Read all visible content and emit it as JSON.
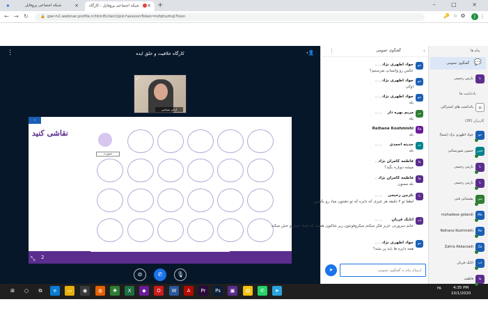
{
  "browser": {
    "tabs": [
      {
        "label": "شبکه اجتماعی پروفایل"
      },
      {
        "label": "شبکه اجتماعی پروفایل - کارگاه"
      }
    ],
    "url": "gwr-h2.webinar.profile.ir/html5client/join?sessionToken=iofqhxzhqi7loxn"
  },
  "session": {
    "title": "کارگاه خلاقیت و خلق ایده"
  },
  "webcam": {
    "label": "آزادی سپاسی"
  },
  "whiteboard": {
    "title": "نقاشی کنید",
    "smiley_label": "صورت",
    "page": "2"
  },
  "chat": {
    "title": "گفتگوی عمومی",
    "input_placeholder": "ارسال پیام به گفتگوی عمومی",
    "messages": [
      {
        "name": "جواد اطهری نژاد",
        "time": "۱۱:۰۶",
        "text": "عکس رو واتساپ بفرستیم؟",
        "avatar": "جو",
        "color": "#1a5fb4"
      },
      {
        "name": "جواد اطهری نژاد",
        "time": "۱۱:۰۶",
        "text": "اوکی",
        "avatar": "جو",
        "color": "#1a5fb4"
      },
      {
        "name": "جواد اطهری نژاد",
        "time": "۱۱:۰۶",
        "text": "بله",
        "avatar": "جو",
        "color": "#1a5fb4"
      },
      {
        "name": "مریم بهره دار",
        "time": "۱۱:۰۶",
        "text": "بله",
        "avatar": "مر",
        "color": "#2e7d32"
      },
      {
        "name": "Reihane Koohmishi",
        "time": "۱۱:۰۶",
        "text": "بله",
        "avatar": "Re",
        "color": "#6a1b9a"
      },
      {
        "name": "حدیثه احمدی",
        "time": "۱۱:۰۶",
        "text": "بله",
        "avatar": "حد",
        "color": "#00838f"
      },
      {
        "name": "فاطمه کامران نژاد",
        "time": "۱۱:۰۶",
        "text": "میشه دوباره بگید؟",
        "avatar": "فا",
        "color": "#5b2d8e"
      },
      {
        "name": "فاطمه کامران نژاد",
        "time": "۱۱:۰۶",
        "text": "بله ممنون",
        "avatar": "فا",
        "color": "#5b2d8e"
      },
      {
        "name": "نازنین رحیمی",
        "time": "۱۱:۰۶",
        "text": "لطفا تو ۴ دقیقه هر چیزی که دایره که تو ذهنتون میاد رو بکشین",
        "avatar": "نا",
        "color": "#5b2d8e"
      },
      {
        "name": "اتابک قربان",
        "time": "۱۱:۰۶",
        "text": "خانم سرورتی عزیز فکر میکنم میکروفونتون زیر شالتون هست که ایجاد خش و خش میکنه",
        "avatar": "ات",
        "color": "#5b2d8e"
      },
      {
        "name": "جواد اطهری نژاد",
        "time": "۱۱:۰۶",
        "text": "همه دایره ها باید پر بشه؟",
        "avatar": "جو",
        "color": "#1a5fb4"
      }
    ]
  },
  "userlist": {
    "messages_header": "پیام ها",
    "public_chat": "گفتگوی عمومی",
    "pinned_user": {
      "name": "نازنین رحیمی",
      "avatar": "نا"
    },
    "notes_header": "یادداشت ها",
    "shared_notes": "یادداشت های اشتراکی",
    "users_header": "کاربران (26)",
    "users": [
      {
        "name": "جواد اطهری نژاد (شما)",
        "avatar": "جو",
        "color": "#1a5fb4"
      },
      {
        "name": "حسین شورستانی",
        "avatar": "حس",
        "color": "#00838f"
      },
      {
        "name": "نازنین رحیمی",
        "avatar": "نا",
        "color": "#5b2d8e"
      },
      {
        "name": "نازنین رحیمی",
        "avatar": "نا",
        "color": "#5b2d8e"
      },
      {
        "name": "پشتیبانی فنی",
        "avatar": "پش",
        "color": "#2e7d32"
      },
      {
        "name": "mohadese golandi",
        "avatar": "Mo",
        "color": "#1a5fb4"
      },
      {
        "name": "Reihane Koohmishi",
        "avatar": "Re",
        "color": "#1a5fb4"
      },
      {
        "name": "Zahra Akbarzadi",
        "avatar": "Za",
        "color": "#1a5fb4"
      },
      {
        "name": "اتابک قربان",
        "avatar": "ات",
        "color": "#1a5fb4"
      },
      {
        "name": "فاطمه",
        "avatar": "فا",
        "color": "#5b2d8e"
      }
    ]
  },
  "taskbar": {
    "time": "4:35 PM",
    "date": "10/1/2020",
    "lang": "FA"
  }
}
